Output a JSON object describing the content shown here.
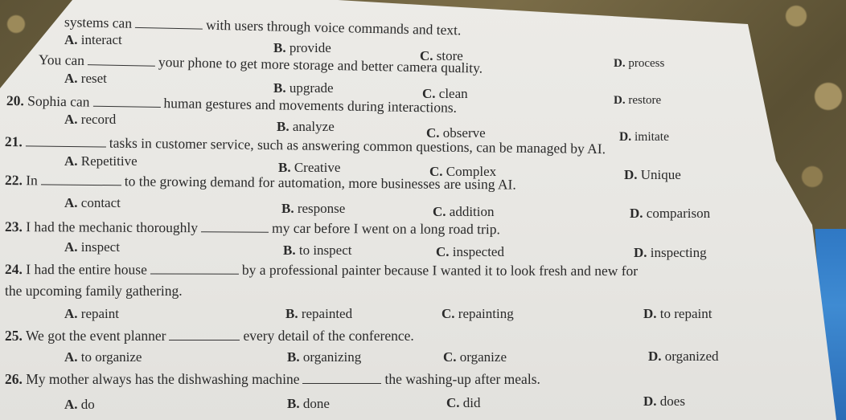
{
  "document": {
    "type": "multiple-choice exercise sheet",
    "questions": [
      {
        "number": "",
        "prefix": "systems can",
        "suffix": "with users through voice commands and text.",
        "options": [
          {
            "letter": "A.",
            "text": "interact"
          },
          {
            "letter": "B.",
            "text": "provide"
          },
          {
            "letter": "C.",
            "text": "store"
          },
          {
            "letter": "D.",
            "text": "process"
          }
        ]
      },
      {
        "number": "",
        "prefix": "You can",
        "suffix": "your phone to get more storage and better camera quality.",
        "options": [
          {
            "letter": "A.",
            "text": "reset"
          },
          {
            "letter": "B.",
            "text": "upgrade"
          },
          {
            "letter": "C.",
            "text": "clean"
          },
          {
            "letter": "D.",
            "text": "restore"
          }
        ]
      },
      {
        "number": "20.",
        "prefix": "Sophia can",
        "suffix": "human gestures and movements during interactions.",
        "options": [
          {
            "letter": "A.",
            "text": "record"
          },
          {
            "letter": "B.",
            "text": "analyze"
          },
          {
            "letter": "C.",
            "text": "observe"
          },
          {
            "letter": "D.",
            "text": "imitate"
          }
        ]
      },
      {
        "number": "21.",
        "prefix": "",
        "suffix": "tasks in customer service, such as answering common questions, can be managed by AI.",
        "options": [
          {
            "letter": "A.",
            "text": "Repetitive"
          },
          {
            "letter": "B.",
            "text": "Creative"
          },
          {
            "letter": "C.",
            "text": "Complex"
          },
          {
            "letter": "D.",
            "text": "Unique"
          }
        ]
      },
      {
        "number": "22.",
        "prefix": "In",
        "suffix": "to the growing demand for automation, more businesses are using AI.",
        "options": [
          {
            "letter": "A.",
            "text": "contact"
          },
          {
            "letter": "B.",
            "text": "response"
          },
          {
            "letter": "C.",
            "text": "addition"
          },
          {
            "letter": "D.",
            "text": "comparison"
          }
        ]
      },
      {
        "number": "23.",
        "prefix": "I had the mechanic thoroughly",
        "suffix": "my car before I went on a long road trip.",
        "options": [
          {
            "letter": "A.",
            "text": "inspect"
          },
          {
            "letter": "B.",
            "text": "to inspect"
          },
          {
            "letter": "C.",
            "text": "inspected"
          },
          {
            "letter": "D.",
            "text": "inspecting"
          }
        ]
      },
      {
        "number": "24.",
        "prefix": "I had the entire house",
        "suffix": "by a professional painter because I wanted it to look fresh and new for",
        "continuation": "the upcoming family gathering.",
        "options": [
          {
            "letter": "A.",
            "text": "repaint"
          },
          {
            "letter": "B.",
            "text": "repainted"
          },
          {
            "letter": "C.",
            "text": "repainting"
          },
          {
            "letter": "D.",
            "text": "to repaint"
          }
        ]
      },
      {
        "number": "25.",
        "prefix": "We got the event planner",
        "suffix": "every detail of the conference.",
        "options": [
          {
            "letter": "A.",
            "text": "to organize"
          },
          {
            "letter": "B.",
            "text": "organizing"
          },
          {
            "letter": "C.",
            "text": "organize"
          },
          {
            "letter": "D.",
            "text": "organized"
          }
        ]
      },
      {
        "number": "26.",
        "prefix": "My mother always has the dishwashing machine",
        "suffix": "the washing-up after meals.",
        "options": [
          {
            "letter": "A.",
            "text": "do"
          },
          {
            "letter": "B.",
            "text": "done"
          },
          {
            "letter": "C.",
            "text": "did"
          },
          {
            "letter": "D.",
            "text": "does"
          }
        ]
      }
    ]
  },
  "colors": {
    "paper": "#e8e7e3",
    "ink": "#2a2a2a",
    "table_wood": "#6f6446",
    "cloth_blue": "#2f78c4"
  }
}
